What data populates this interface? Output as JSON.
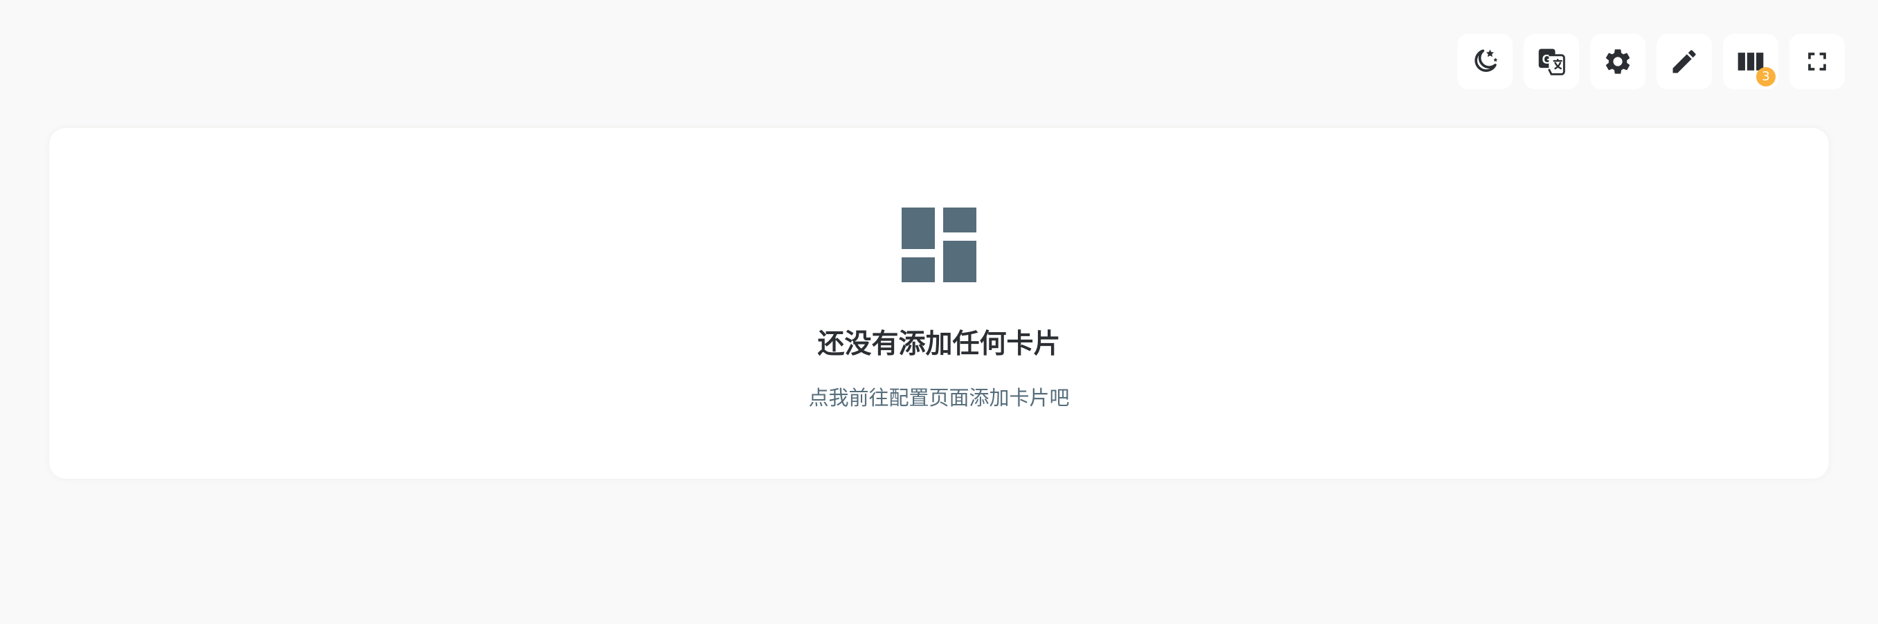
{
  "toolbar": {
    "buttons": [
      {
        "icon": "theme-night-icon"
      },
      {
        "icon": "translate-icon"
      },
      {
        "icon": "gear-icon"
      },
      {
        "icon": "pencil-icon"
      },
      {
        "icon": "columns-icon",
        "badge": "3"
      },
      {
        "icon": "fullscreen-icon"
      }
    ]
  },
  "empty_state": {
    "icon": "dashboard-icon",
    "title": "还没有添加任何卡片",
    "subtitle": "点我前往配置页面添加卡片吧"
  },
  "colors": {
    "background": "#f9f9f9",
    "panel": "#ffffff",
    "icon": "#2b2f33",
    "dashboard_icon": "#566d7b",
    "badge": "#fbb03b",
    "title": "#2b2f33",
    "subtitle": "#566d7b"
  }
}
